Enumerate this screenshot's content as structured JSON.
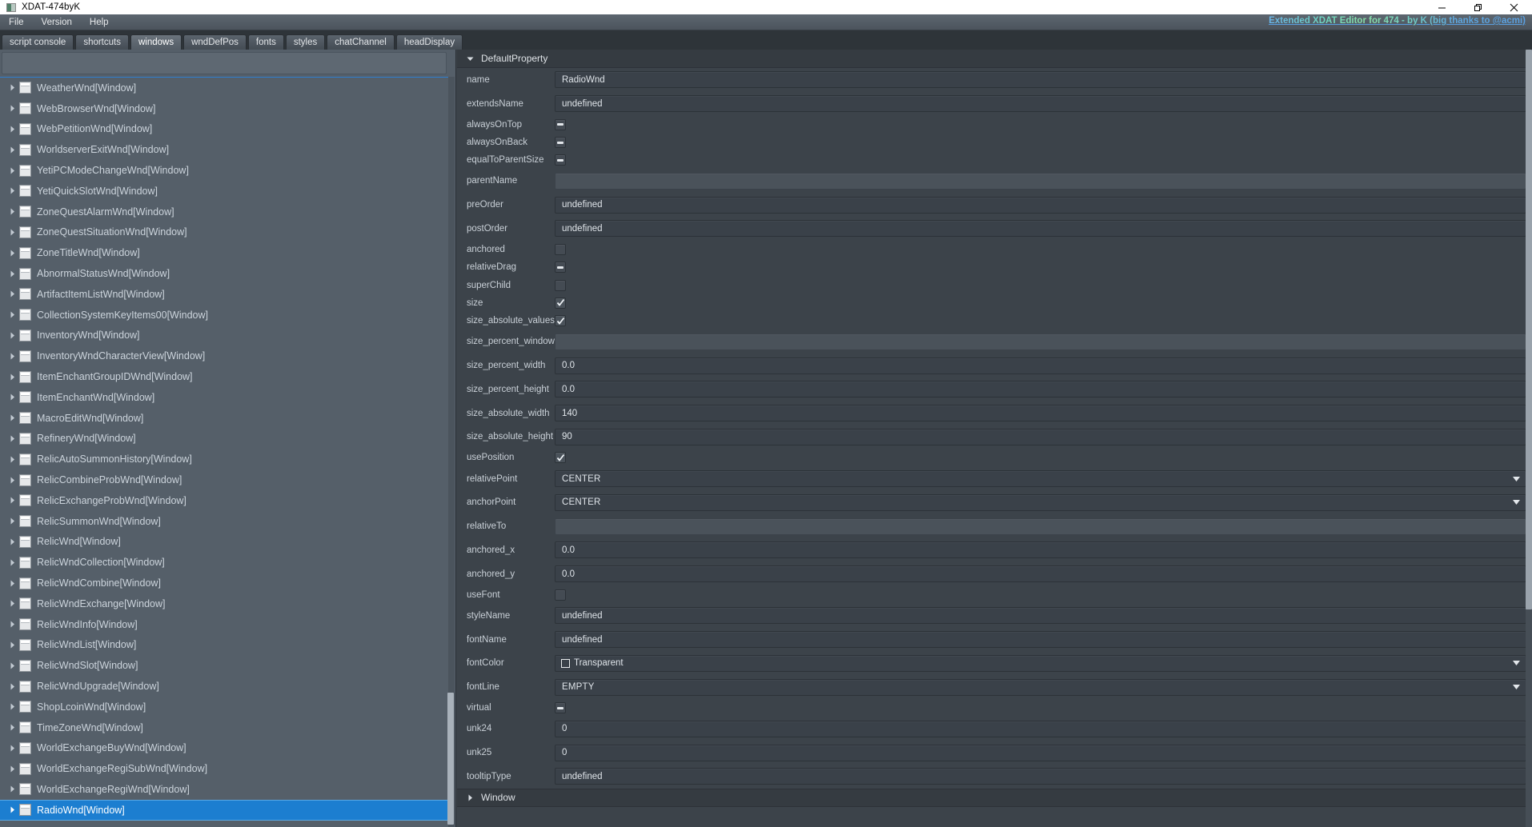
{
  "titlebar": {
    "title": "XDAT-474byK",
    "icon": "app-icon",
    "minimize": "minimize-icon",
    "maximize": "restore-icon",
    "close": "close-icon"
  },
  "menubar": {
    "items": [
      {
        "label": "File"
      },
      {
        "label": "Version"
      },
      {
        "label": "Help"
      }
    ],
    "link": "Extended XDAT Editor for 474 - by K (big thanks to @acmi)",
    "link_color": "#6ab4e8"
  },
  "tabs": [
    {
      "label": "script console",
      "active": false
    },
    {
      "label": "shortcuts",
      "active": false
    },
    {
      "label": "windows",
      "active": true
    },
    {
      "label": "wndDefPos",
      "active": false
    },
    {
      "label": "fonts",
      "active": false
    },
    {
      "label": "styles",
      "active": false
    },
    {
      "label": "chatChannel",
      "active": false
    },
    {
      "label": "headDisplay",
      "active": false
    }
  ],
  "tree": {
    "filter_value": "",
    "filter_placeholder": "",
    "selection_color": "#1c7ed0",
    "items": [
      {
        "label": "WeatherWnd[Window]",
        "selected": false
      },
      {
        "label": "WebBrowserWnd[Window]",
        "selected": false
      },
      {
        "label": "WebPetitionWnd[Window]",
        "selected": false
      },
      {
        "label": "WorldserverExitWnd[Window]",
        "selected": false
      },
      {
        "label": "YetiPCModeChangeWnd[Window]",
        "selected": false
      },
      {
        "label": "YetiQuickSlotWnd[Window]",
        "selected": false
      },
      {
        "label": "ZoneQuestAlarmWnd[Window]",
        "selected": false
      },
      {
        "label": "ZoneQuestSituationWnd[Window]",
        "selected": false
      },
      {
        "label": "ZoneTitleWnd[Window]",
        "selected": false
      },
      {
        "label": "AbnormalStatusWnd[Window]",
        "selected": false
      },
      {
        "label": "ArtifactItemListWnd[Window]",
        "selected": false
      },
      {
        "label": "CollectionSystemKeyItems00[Window]",
        "selected": false
      },
      {
        "label": "InventoryWnd[Window]",
        "selected": false
      },
      {
        "label": "InventoryWndCharacterView[Window]",
        "selected": false
      },
      {
        "label": "ItemEnchantGroupIDWnd[Window]",
        "selected": false
      },
      {
        "label": "ItemEnchantWnd[Window]",
        "selected": false
      },
      {
        "label": "MacroEditWnd[Window]",
        "selected": false
      },
      {
        "label": "RefineryWnd[Window]",
        "selected": false
      },
      {
        "label": "RelicAutoSummonHistory[Window]",
        "selected": false
      },
      {
        "label": "RelicCombineProbWnd[Window]",
        "selected": false
      },
      {
        "label": "RelicExchangeProbWnd[Window]",
        "selected": false
      },
      {
        "label": "RelicSummonWnd[Window]",
        "selected": false
      },
      {
        "label": "RelicWnd[Window]",
        "selected": false
      },
      {
        "label": "RelicWndCollection[Window]",
        "selected": false
      },
      {
        "label": "RelicWndCombine[Window]",
        "selected": false
      },
      {
        "label": "RelicWndExchange[Window]",
        "selected": false
      },
      {
        "label": "RelicWndInfo[Window]",
        "selected": false
      },
      {
        "label": "RelicWndList[Window]",
        "selected": false
      },
      {
        "label": "RelicWndSlot[Window]",
        "selected": false
      },
      {
        "label": "RelicWndUpgrade[Window]",
        "selected": false
      },
      {
        "label": "ShopLcoinWnd[Window]",
        "selected": false
      },
      {
        "label": "TimeZoneWnd[Window]",
        "selected": false
      },
      {
        "label": "WorldExchangeBuyWnd[Window]",
        "selected": false
      },
      {
        "label": "WorldExchangeRegiSubWnd[Window]",
        "selected": false
      },
      {
        "label": "WorldExchangeRegiWnd[Window]",
        "selected": false
      },
      {
        "label": "RadioWnd[Window]",
        "selected": true
      }
    ]
  },
  "properties": {
    "section_title": "DefaultProperty",
    "section_expanded": true,
    "rows": [
      {
        "label": "name",
        "kind": "text",
        "value": "RadioWnd"
      },
      {
        "label": "extendsName",
        "kind": "text",
        "value": "undefined"
      },
      {
        "label": "alwaysOnTop",
        "kind": "checkbox",
        "state": "dash"
      },
      {
        "label": "alwaysOnBack",
        "kind": "checkbox",
        "state": "dash"
      },
      {
        "label": "equalToParentSize",
        "kind": "checkbox",
        "state": "dash"
      },
      {
        "label": "parentName",
        "kind": "blank",
        "value": ""
      },
      {
        "label": "preOrder",
        "kind": "text",
        "value": "undefined"
      },
      {
        "label": "postOrder",
        "kind": "text",
        "value": "undefined"
      },
      {
        "label": "anchored",
        "kind": "checkbox",
        "state": "empty"
      },
      {
        "label": "relativeDrag",
        "kind": "checkbox",
        "state": "dash"
      },
      {
        "label": "superChild",
        "kind": "checkbox",
        "state": "empty"
      },
      {
        "label": "size",
        "kind": "checkbox",
        "state": "checked"
      },
      {
        "label": "size_absolute_values",
        "kind": "checkbox",
        "state": "checked"
      },
      {
        "label": "size_percent_window",
        "kind": "blank",
        "value": ""
      },
      {
        "label": "size_percent_width",
        "kind": "text",
        "value": "0.0"
      },
      {
        "label": "size_percent_height",
        "kind": "text",
        "value": "0.0"
      },
      {
        "label": "size_absolute_width",
        "kind": "text",
        "value": "140"
      },
      {
        "label": "size_absolute_height",
        "kind": "text",
        "value": "90"
      },
      {
        "label": "usePosition",
        "kind": "checkbox",
        "state": "checked"
      },
      {
        "label": "relativePoint",
        "kind": "dropdown",
        "value": "CENTER"
      },
      {
        "label": "anchorPoint",
        "kind": "dropdown",
        "value": "CENTER"
      },
      {
        "label": "relativeTo",
        "kind": "blank",
        "value": ""
      },
      {
        "label": "anchored_x",
        "kind": "text",
        "value": "0.0"
      },
      {
        "label": "anchored_y",
        "kind": "text",
        "value": "0.0"
      },
      {
        "label": "useFont",
        "kind": "checkbox",
        "state": "empty"
      },
      {
        "label": "styleName",
        "kind": "text",
        "value": "undefined"
      },
      {
        "label": "fontName",
        "kind": "text",
        "value": "undefined"
      },
      {
        "label": "fontColor",
        "kind": "color",
        "value": "Transparent"
      },
      {
        "label": "fontLine",
        "kind": "dropdown",
        "value": "EMPTY"
      },
      {
        "label": "virtual",
        "kind": "checkbox",
        "state": "dash"
      },
      {
        "label": "unk24",
        "kind": "text",
        "value": "0"
      },
      {
        "label": "unk25",
        "kind": "text",
        "value": "0"
      },
      {
        "label": "tooltipType",
        "kind": "text",
        "value": "undefined"
      }
    ],
    "collapsed_section_title": "Window",
    "collapsed_section_expanded": false
  }
}
